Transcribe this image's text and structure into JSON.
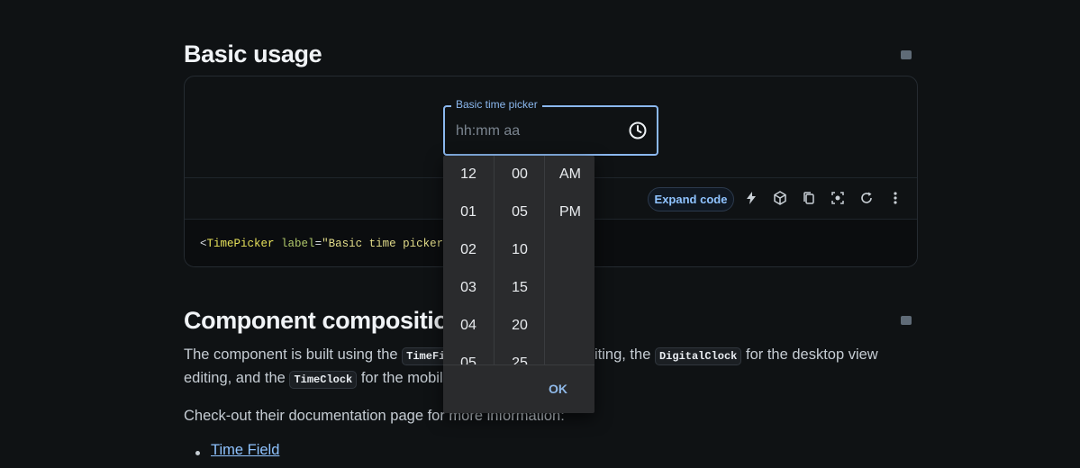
{
  "section1": {
    "title": "Basic usage"
  },
  "demo": {
    "field_label": "Basic time picker",
    "placeholder": "hh:mm aa",
    "clock_icon": "clock-icon",
    "expand_code": "Expand code",
    "toolbar_icons": [
      "bolt-icon",
      "cube-icon",
      "copy-icon",
      "screenshot-icon",
      "reset-icon",
      "more-vertical-icon"
    ],
    "code": {
      "open": "<",
      "tag": "TimePicker",
      "attr": "label",
      "eq": "=",
      "value": "\"Basic time picker\""
    }
  },
  "picker": {
    "hours": [
      "12",
      "01",
      "02",
      "03",
      "04",
      "05"
    ],
    "minutes": [
      "00",
      "05",
      "10",
      "15",
      "20",
      "25"
    ],
    "meridiem": [
      "AM",
      "PM"
    ],
    "ok": "OK"
  },
  "section2": {
    "title": "Component compositio",
    "p1_a": "The component is built using the",
    "code_timefield": "TimeFi",
    "p1_b": "iting, the",
    "code_digitalclock": "DigitalClock",
    "p1_c": "for the desktop view",
    "p2_a": "editing, and the",
    "code_timeclock": "TimeClock",
    "p2_b": "for the mobile",
    "p3": "Check-out their documentation page for more information:",
    "links": [
      "Time Field"
    ]
  }
}
